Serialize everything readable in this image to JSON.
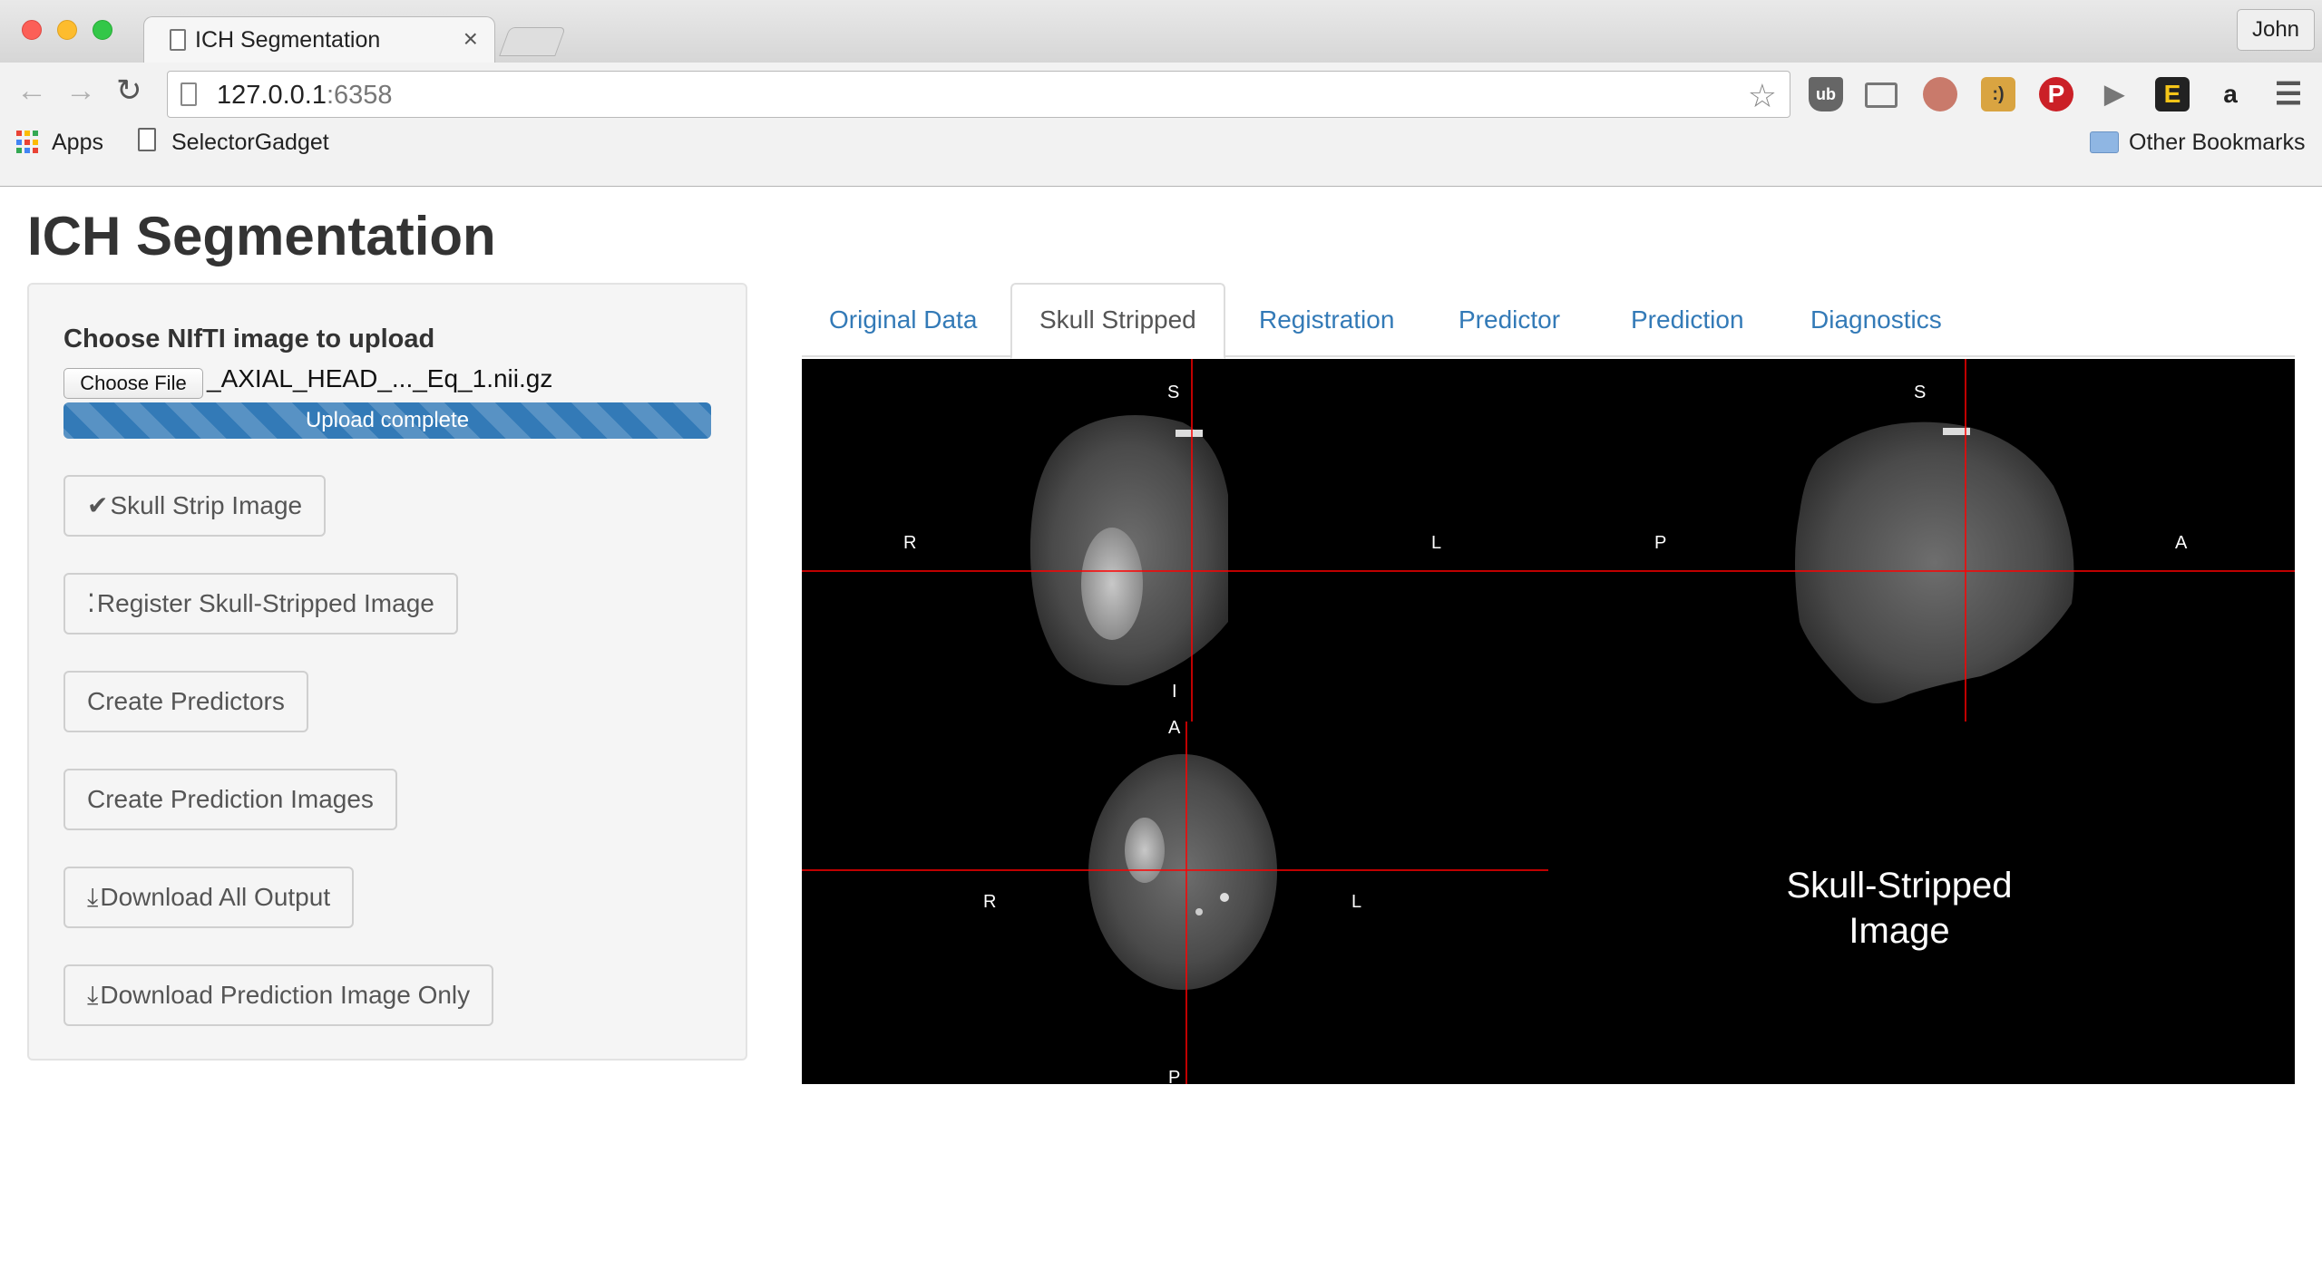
{
  "browser": {
    "tab_title": "ICH Segmentation",
    "tab_close": "×",
    "profile_name": "John",
    "url_host": "127.0.0.1",
    "url_port": ":6358",
    "bookmarks": {
      "apps": "Apps",
      "selector_gadget": "SelectorGadget",
      "other": "Other Bookmarks"
    }
  },
  "app": {
    "title": "ICH Segmentation"
  },
  "sidebar": {
    "upload_label": "Choose NIfTI image to upload",
    "choose_file_button": "Choose File",
    "file_name": "_AXIAL_HEAD_..._Eq_1.nii.gz",
    "progress_text": "Upload complete",
    "progress_fraction": 1.0,
    "buttons": [
      {
        "icon": "checkmark-icon",
        "label": "Skull Strip Image"
      },
      {
        "icon": "spinner-icon",
        "label": "Register Skull-Stripped Image"
      },
      {
        "icon": "",
        "label": "Create Predictors"
      },
      {
        "icon": "",
        "label": "Create Prediction Images"
      },
      {
        "icon": "download-icon",
        "label": "Download All Output"
      },
      {
        "icon": "download-icon",
        "label": "Download Prediction Image Only"
      }
    ]
  },
  "tabs": [
    {
      "label": "Original Data",
      "active": false
    },
    {
      "label": "Skull Stripped",
      "active": true
    },
    {
      "label": "Registration",
      "active": false
    },
    {
      "label": "Predictor",
      "active": false
    },
    {
      "label": "Prediction",
      "active": false
    },
    {
      "label": "Diagnostics",
      "active": false
    }
  ],
  "viewer": {
    "coronal": {
      "top": "S",
      "bottom": "I",
      "left": "R",
      "right": "L"
    },
    "sagittal": {
      "top": "S",
      "left": "P",
      "right": "A"
    },
    "axial": {
      "top": "A",
      "bottom": "P",
      "left": "R",
      "right": "L"
    },
    "caption_line1": "Skull-Stripped",
    "caption_line2": "Image",
    "crosshair_color": "#ff0000"
  },
  "colors": {
    "link": "#337ab7",
    "progress": "#337ab7"
  }
}
